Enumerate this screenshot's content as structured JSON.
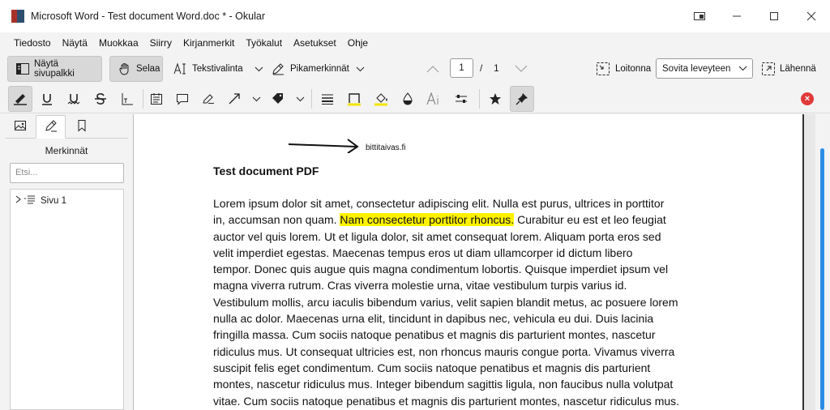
{
  "window": {
    "title": "Microsoft Word - Test document Word.doc * - Okular"
  },
  "menubar": {
    "items": [
      "Tiedosto",
      "Näytä",
      "Muokkaa",
      "Siirry",
      "Kirjanmerkit",
      "Työkalut",
      "Asetukset",
      "Ohje"
    ]
  },
  "toolbar": {
    "show_sidebar": "Näytä sivupalkki",
    "browse": "Selaa",
    "text_selection": "Tekstivalinta",
    "quick_annotations": "Pikamerkinnät",
    "current_page": "1",
    "page_separator": "/",
    "total_pages": "1",
    "zoom_out": "Loitonna",
    "zoom_mode": "Sovita leveyteen",
    "zoom_in": "Lähennä"
  },
  "annotation_toolbar": {
    "tools": [
      "highlighter",
      "underline",
      "squiggle",
      "strikeout",
      "typewriter",
      "inline-note",
      "popup-note",
      "freehand-line",
      "arrow",
      "stamp",
      "line-width",
      "color",
      "fill-color",
      "opacity",
      "font",
      "settings",
      "favourite",
      "pin"
    ],
    "color_accent": "#f5e400",
    "close_color": "#e03a3a"
  },
  "sidebar": {
    "title": "Merkinnät",
    "search_placeholder": "Etsi...",
    "tree": [
      {
        "label": "Sivu 1"
      }
    ]
  },
  "document": {
    "annotation_text": "bittitaivas.fi",
    "title": "Test document PDF",
    "lines": [
      {
        "before": "Lorem ipsum dolor sit amet, consectetur adipiscing elit. Nulla est purus, ultrices in porttitor",
        "highlight": "",
        "after": ""
      },
      {
        "before": "in, accumsan non quam. ",
        "highlight": "Nam consectetur porttitor rhoncus.",
        "after": " Curabitur eu est et leo feugiat"
      },
      {
        "before": "auctor vel quis lorem. Ut et ligula dolor, sit amet consequat lorem. Aliquam porta eros sed",
        "highlight": "",
        "after": ""
      },
      {
        "before": "velit imperdiet egestas. Maecenas tempus eros ut diam ullamcorper id dictum libero",
        "highlight": "",
        "after": ""
      },
      {
        "before": "tempor. Donec quis augue quis magna condimentum lobortis. Quisque imperdiet ipsum vel",
        "highlight": "",
        "after": ""
      },
      {
        "before": "magna viverra rutrum. Cras viverra molestie urna, vitae vestibulum turpis varius id.",
        "highlight": "",
        "after": ""
      },
      {
        "before": "Vestibulum mollis, arcu iaculis bibendum varius, velit sapien blandit metus, ac posuere lorem",
        "highlight": "",
        "after": ""
      },
      {
        "before": "nulla ac dolor. Maecenas urna elit, tincidunt in dapibus nec, vehicula eu dui. Duis lacinia",
        "highlight": "",
        "after": ""
      },
      {
        "before": "fringilla massa. Cum sociis natoque penatibus et magnis dis parturient montes, nascetur",
        "highlight": "",
        "after": ""
      },
      {
        "before": "ridiculus mus. Ut consequat ultricies est, non rhoncus mauris congue porta. Vivamus viverra",
        "highlight": "",
        "after": ""
      },
      {
        "before": "suscipit felis eget condimentum. Cum sociis natoque penatibus et magnis dis parturient",
        "highlight": "",
        "after": ""
      },
      {
        "before": "montes, nascetur ridiculus mus. Integer bibendum sagittis ligula, non faucibus nulla volutpat",
        "highlight": "",
        "after": ""
      },
      {
        "before": "vitae. Cum sociis natoque penatibus et magnis dis parturient montes, nascetur ridiculus mus.",
        "highlight": "",
        "after": ""
      }
    ],
    "highlight_color": "#fff200"
  }
}
